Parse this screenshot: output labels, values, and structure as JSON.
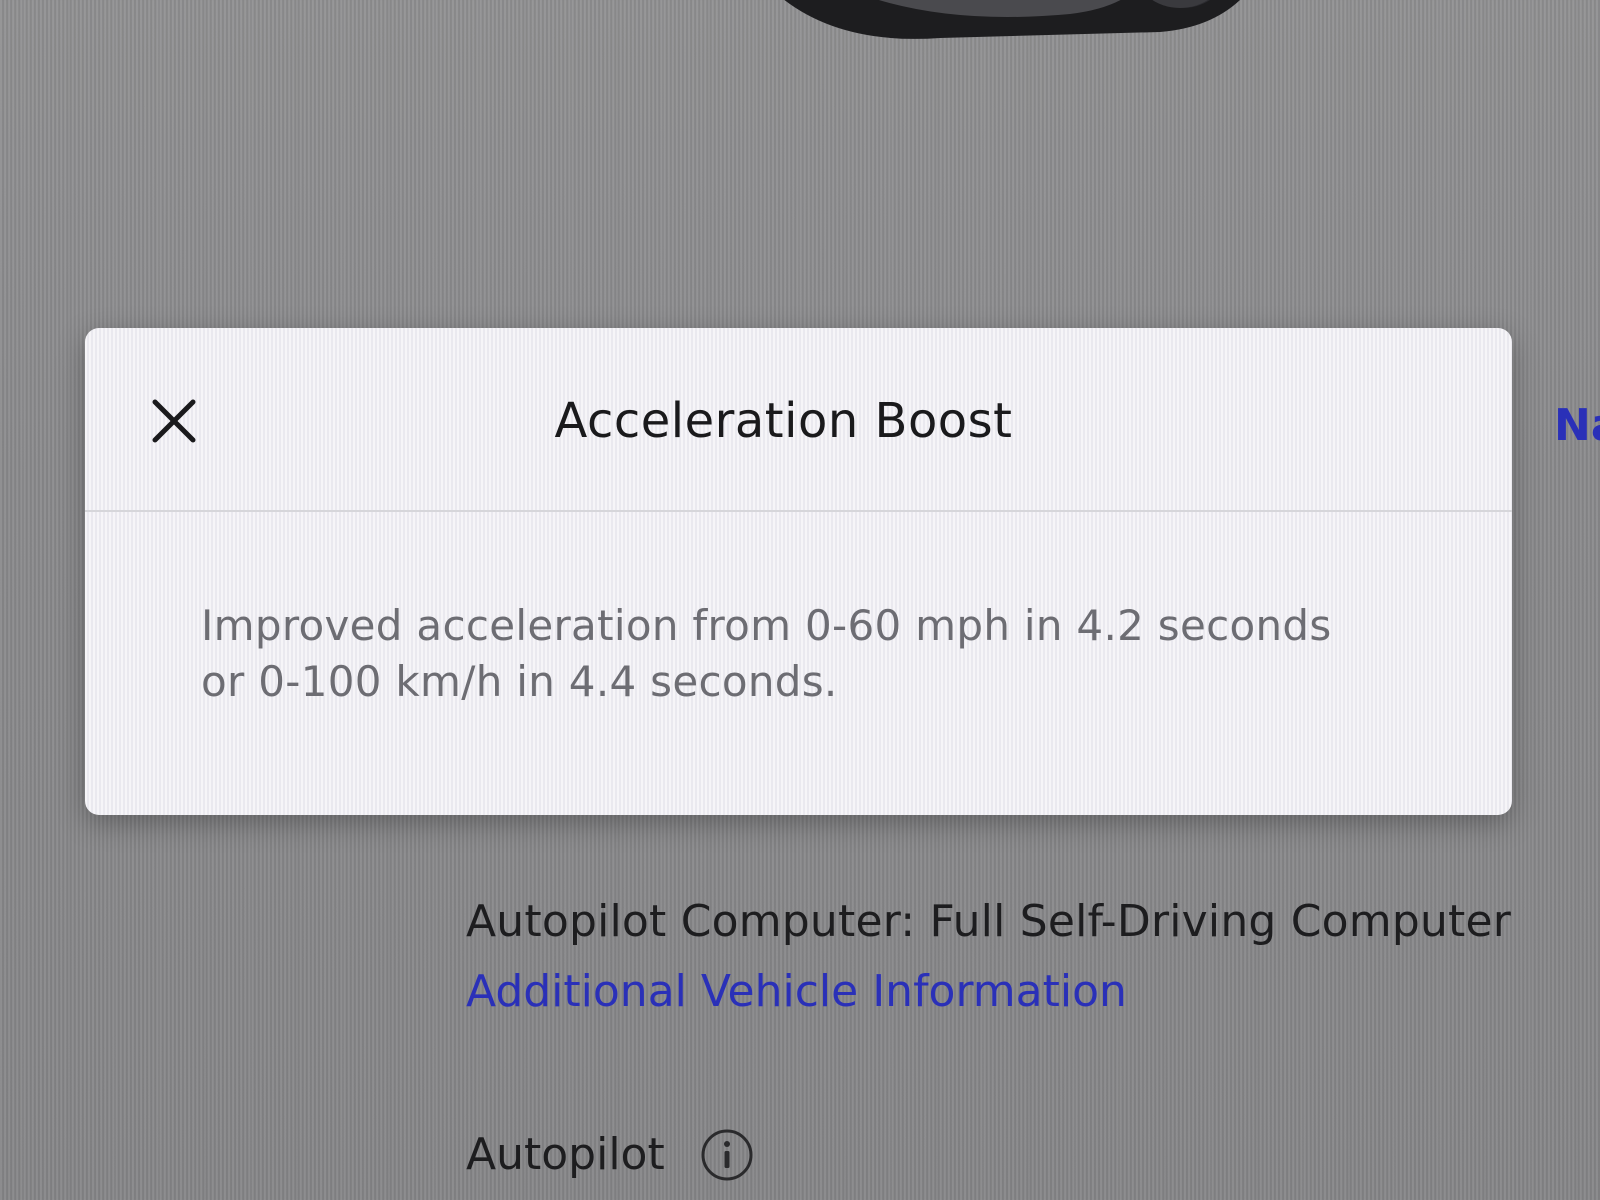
{
  "modal": {
    "title": "Acceleration Boost",
    "close_icon": "close-icon",
    "body_line1": "Improved acceleration from 0-60 mph in 4.2 seconds",
    "body_line2": "or 0-100 km/h in 4.4 seconds."
  },
  "background": {
    "right_link_partial": "Na",
    "computer_line": "Autopilot Computer: Full Self-Driving Computer",
    "additional_info_link": "Additional Vehicle Information",
    "autopilot_label": "Autopilot",
    "info_icon": "info-icon"
  },
  "colors": {
    "link": "#2a30b8",
    "modal_bg": "#f1f0f4",
    "page_bg": "#8e8e90",
    "title_text": "#1a1a1c",
    "body_text": "#6d6d73"
  }
}
